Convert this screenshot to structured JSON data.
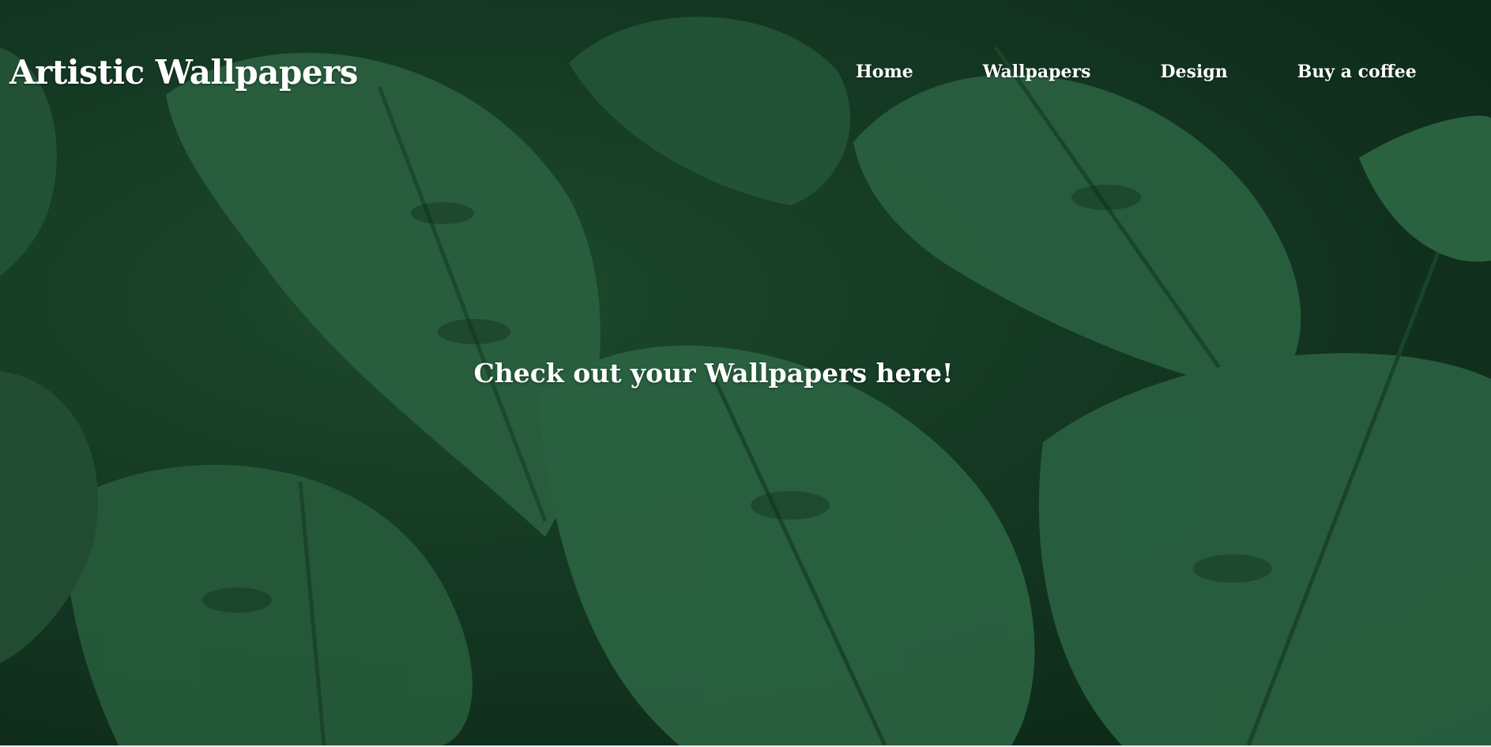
{
  "header": {
    "site_title": "Artistic Wallpapers"
  },
  "nav": {
    "items": [
      {
        "label": "Home"
      },
      {
        "label": "Wallpapers"
      },
      {
        "label": "Design"
      },
      {
        "label": "Buy a coffee"
      }
    ]
  },
  "hero": {
    "text": "Check out your Wallpapers here!",
    "background": "monstera-leaves-image"
  },
  "colors": {
    "background_dark": "#0b2514",
    "leaf_green": "#2c6b42",
    "text": "#ffffff"
  }
}
